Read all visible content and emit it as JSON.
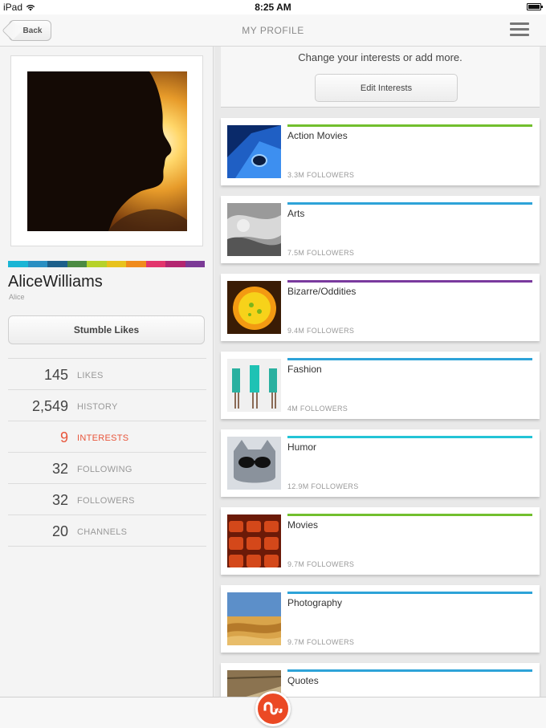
{
  "status_bar": {
    "carrier": "iPad",
    "time": "8:25 AM"
  },
  "nav": {
    "back_label": "Back",
    "title": "MY PROFILE",
    "menu_icon": "hamburger-menu-icon"
  },
  "profile": {
    "name": "AliceWilliams",
    "handle": "Alice",
    "stumble_likes_label": "Stumble Likes",
    "color_strip": [
      "#1ab5d5",
      "#2a8fc2",
      "#1d5f8a",
      "#4b8a42",
      "#b6d22a",
      "#e8c21c",
      "#f08b1c",
      "#e2356c",
      "#b32670",
      "#7b3a96"
    ],
    "stats": [
      {
        "value": "145",
        "label": "LIKES",
        "active": false
      },
      {
        "value": "2,549",
        "label": "HISTORY",
        "active": false
      },
      {
        "value": "9",
        "label": "INTERESTS",
        "active": true
      },
      {
        "value": "32",
        "label": "FOLLOWING",
        "active": false
      },
      {
        "value": "32",
        "label": "FOLLOWERS",
        "active": false
      },
      {
        "value": "20",
        "label": "CHANNELS",
        "active": false
      }
    ]
  },
  "interests_panel": {
    "caption": "Change your interests or add more.",
    "edit_button": "Edit Interests",
    "items": [
      {
        "name": "Action Movies",
        "followers": "3.3M FOLLOWERS",
        "accent": "#72bf2e",
        "thumb": "action-movies-thumbnail"
      },
      {
        "name": "Arts",
        "followers": "7.5M FOLLOWERS",
        "accent": "#2ea3d8",
        "thumb": "arts-thumbnail"
      },
      {
        "name": "Bizarre/Oddities",
        "followers": "9.4M FOLLOWERS",
        "accent": "#7a3a9e",
        "thumb": "bizarre-thumbnail"
      },
      {
        "name": "Fashion",
        "followers": "4M FOLLOWERS",
        "accent": "#2ea3d8",
        "thumb": "fashion-thumbnail"
      },
      {
        "name": "Humor",
        "followers": "12.9M FOLLOWERS",
        "accent": "#23c4d6",
        "thumb": "humor-thumbnail"
      },
      {
        "name": "Movies",
        "followers": "9.7M FOLLOWERS",
        "accent": "#72bf2e",
        "thumb": "movies-thumbnail"
      },
      {
        "name": "Photography",
        "followers": "9.7M FOLLOWERS",
        "accent": "#2ea3d8",
        "thumb": "photography-thumbnail"
      },
      {
        "name": "Quotes",
        "followers": "",
        "accent": "#2ea3d8",
        "thumb": "quotes-thumbnail"
      }
    ]
  },
  "bottom_bar": {
    "logo_icon": "stumbleupon-logo-icon",
    "logo_color": "#eb4924"
  }
}
